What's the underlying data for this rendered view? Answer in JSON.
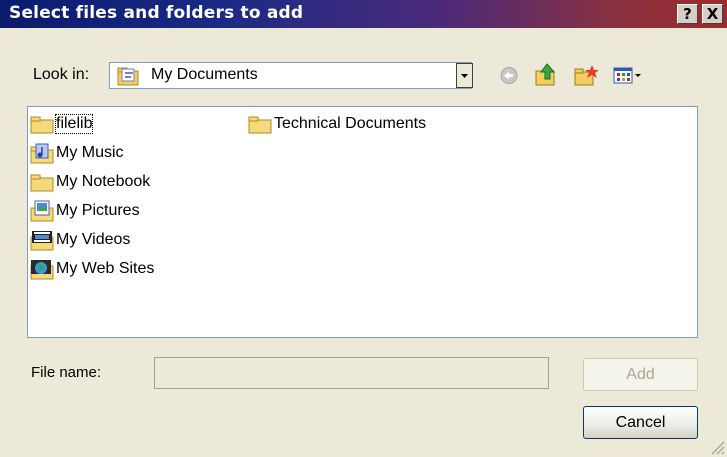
{
  "window": {
    "title": "Select files and folders to add"
  },
  "title_buttons": {
    "help": "?",
    "close": "X"
  },
  "look_in": {
    "label": "Look in:",
    "label_underline_char": "i",
    "value": "My Documents"
  },
  "toolbar": {
    "icons": [
      "back-icon",
      "up-folder-icon",
      "new-folder-icon",
      "view-menu-icon"
    ]
  },
  "files": [
    {
      "name": "filelib",
      "icon": "folder-icon"
    },
    {
      "name": "My Music",
      "icon": "music-folder-icon"
    },
    {
      "name": "My Notebook",
      "icon": "folder-icon"
    },
    {
      "name": "My Pictures",
      "icon": "pictures-folder-icon"
    },
    {
      "name": "My Videos",
      "icon": "videos-folder-icon"
    },
    {
      "name": "My Web Sites",
      "icon": "web-folder-icon"
    },
    {
      "name": "Technical Documents",
      "icon": "folder-icon"
    }
  ],
  "file_name": {
    "label": "File name:",
    "value": ""
  },
  "buttons": {
    "add": "Add",
    "cancel": "Cancel"
  },
  "colors": {
    "title_left": "#0a1b6e",
    "title_right": "#9c2a2a",
    "folder": "#f5d97a"
  }
}
